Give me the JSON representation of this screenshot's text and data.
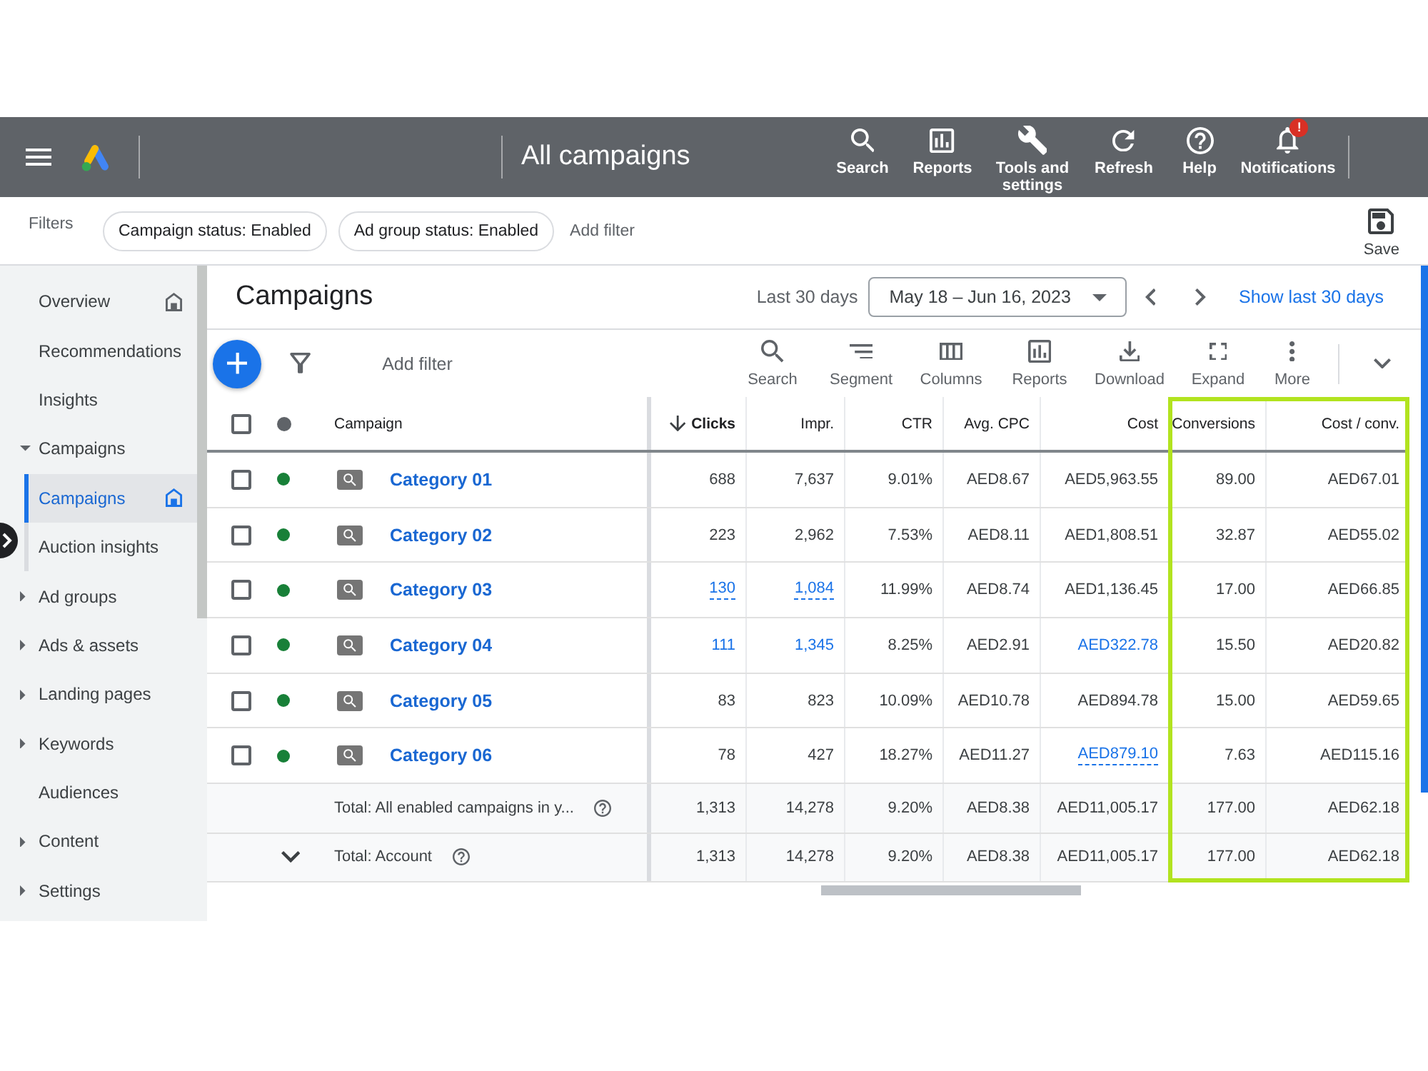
{
  "header": {
    "title": "All campaigns",
    "actions": [
      {
        "label": "Search"
      },
      {
        "label": "Reports"
      },
      {
        "label": "Tools and settings"
      },
      {
        "label": "Refresh"
      },
      {
        "label": "Help"
      },
      {
        "label": "Notifications",
        "badge": "!"
      }
    ]
  },
  "filters": {
    "label": "Filters",
    "chips": [
      "Campaign status: Enabled",
      "Ad group status: Enabled"
    ],
    "add_filter": "Add filter",
    "save": "Save"
  },
  "sidebar": {
    "items": [
      {
        "label": "Overview",
        "kind": "home",
        "selected": false
      },
      {
        "label": "Recommendations",
        "kind": "page",
        "selected": false
      },
      {
        "label": "Insights",
        "kind": "page",
        "selected": false
      },
      {
        "label": "Campaigns",
        "kind": "section",
        "expanded": true,
        "selected": false,
        "children": [
          {
            "label": "Campaigns",
            "kind": "home",
            "selected": true
          },
          {
            "label": "Auction insights",
            "kind": "page",
            "selected": false
          }
        ]
      },
      {
        "label": "Ad groups",
        "kind": "section",
        "expanded": false,
        "selected": false
      },
      {
        "label": "Ads & assets",
        "kind": "section",
        "expanded": false,
        "selected": false
      },
      {
        "label": "Landing pages",
        "kind": "section",
        "expanded": false,
        "selected": false
      },
      {
        "label": "Keywords",
        "kind": "section",
        "expanded": false,
        "selected": false
      },
      {
        "label": "Audiences",
        "kind": "page",
        "selected": false
      },
      {
        "label": "Content",
        "kind": "section",
        "expanded": false,
        "selected": false
      },
      {
        "label": "Settings",
        "kind": "section",
        "expanded": false,
        "selected": false
      }
    ]
  },
  "page": {
    "title": "Campaigns",
    "period": "Last 30 days",
    "date_range": "May 18 – Jun 16, 2023",
    "show_last": "Show last 30 days"
  },
  "toolbar": {
    "add_filter": "Add filter",
    "tools": [
      {
        "label": "Search"
      },
      {
        "label": "Segment"
      },
      {
        "label": "Columns"
      },
      {
        "label": "Reports"
      },
      {
        "label": "Download"
      },
      {
        "label": "Expand"
      },
      {
        "label": "More"
      }
    ]
  },
  "table": {
    "select_all": {
      "checked": false
    },
    "columns": [
      {
        "label": "Campaign",
        "sorted": false,
        "highlighted": false
      },
      {
        "label": "Clicks",
        "sorted": true,
        "highlighted": false
      },
      {
        "label": "Impr.",
        "sorted": false,
        "highlighted": false
      },
      {
        "label": "CTR",
        "sorted": false,
        "highlighted": false
      },
      {
        "label": "Avg. CPC",
        "sorted": false,
        "highlighted": false
      },
      {
        "label": "Cost",
        "sorted": false,
        "highlighted": false
      },
      {
        "label": "Conversions",
        "sorted": false,
        "highlighted": true
      },
      {
        "label": "Cost / conv.",
        "sorted": false,
        "highlighted": true
      }
    ],
    "rows": [
      {
        "checked": false,
        "enabled": true,
        "cells": [
          {
            "text": "Category 01",
            "kind": "campaign"
          },
          {
            "text": "688",
            "kind": "plain"
          },
          {
            "text": "7,637",
            "kind": "plain"
          },
          {
            "text": "9.01%",
            "kind": "plain"
          },
          {
            "text": "AED8.67",
            "kind": "plain"
          },
          {
            "text": "AED5,963.55",
            "kind": "plain"
          },
          {
            "text": "89.00",
            "kind": "plain"
          },
          {
            "text": "AED67.01",
            "kind": "plain"
          }
        ]
      },
      {
        "checked": false,
        "enabled": true,
        "cells": [
          {
            "text": "Category 02",
            "kind": "campaign"
          },
          {
            "text": "223",
            "kind": "plain"
          },
          {
            "text": "2,962",
            "kind": "plain"
          },
          {
            "text": "7.53%",
            "kind": "plain"
          },
          {
            "text": "AED8.11",
            "kind": "plain"
          },
          {
            "text": "AED1,808.51",
            "kind": "plain"
          },
          {
            "text": "32.87",
            "kind": "plain"
          },
          {
            "text": "AED55.02",
            "kind": "plain"
          }
        ]
      },
      {
        "checked": false,
        "enabled": true,
        "cells": [
          {
            "text": "Category 03",
            "kind": "campaign"
          },
          {
            "text": "130",
            "kind": "dotted"
          },
          {
            "text": "1,084",
            "kind": "dotted"
          },
          {
            "text": "11.99%",
            "kind": "plain"
          },
          {
            "text": "AED8.74",
            "kind": "plain"
          },
          {
            "text": "AED1,136.45",
            "kind": "plain"
          },
          {
            "text": "17.00",
            "kind": "plain"
          },
          {
            "text": "AED66.85",
            "kind": "plain"
          }
        ]
      },
      {
        "checked": false,
        "enabled": true,
        "cells": [
          {
            "text": "Category 04",
            "kind": "campaign"
          },
          {
            "text": "111",
            "kind": "link"
          },
          {
            "text": "1,345",
            "kind": "link"
          },
          {
            "text": "8.25%",
            "kind": "plain"
          },
          {
            "text": "AED2.91",
            "kind": "plain"
          },
          {
            "text": "AED322.78",
            "kind": "link"
          },
          {
            "text": "15.50",
            "kind": "plain"
          },
          {
            "text": "AED20.82",
            "kind": "plain"
          }
        ]
      },
      {
        "checked": false,
        "enabled": true,
        "cells": [
          {
            "text": "Category 05",
            "kind": "campaign"
          },
          {
            "text": "83",
            "kind": "plain"
          },
          {
            "text": "823",
            "kind": "plain"
          },
          {
            "text": "10.09%",
            "kind": "plain"
          },
          {
            "text": "AED10.78",
            "kind": "plain"
          },
          {
            "text": "AED894.78",
            "kind": "plain"
          },
          {
            "text": "15.00",
            "kind": "plain"
          },
          {
            "text": "AED59.65",
            "kind": "plain"
          }
        ]
      },
      {
        "checked": false,
        "enabled": true,
        "cells": [
          {
            "text": "Category 06",
            "kind": "campaign"
          },
          {
            "text": "78",
            "kind": "plain"
          },
          {
            "text": "427",
            "kind": "plain"
          },
          {
            "text": "18.27%",
            "kind": "plain"
          },
          {
            "text": "AED11.27",
            "kind": "plain"
          },
          {
            "text": "AED879.10",
            "kind": "dotted"
          },
          {
            "text": "7.63",
            "kind": "plain"
          },
          {
            "text": "AED115.16",
            "kind": "plain"
          }
        ]
      }
    ],
    "totals": [
      {
        "kind": "filtered",
        "cells": [
          "Total: All enabled campaigns in y...",
          "1,313",
          "14,278",
          "9.20%",
          "AED8.38",
          "AED11,005.17",
          "177.00",
          "AED62.18"
        ]
      },
      {
        "kind": "account",
        "cells": [
          "Total: Account",
          "1,313",
          "14,278",
          "9.20%",
          "AED8.38",
          "AED11,005.17",
          "177.00",
          "AED62.18"
        ]
      }
    ]
  }
}
